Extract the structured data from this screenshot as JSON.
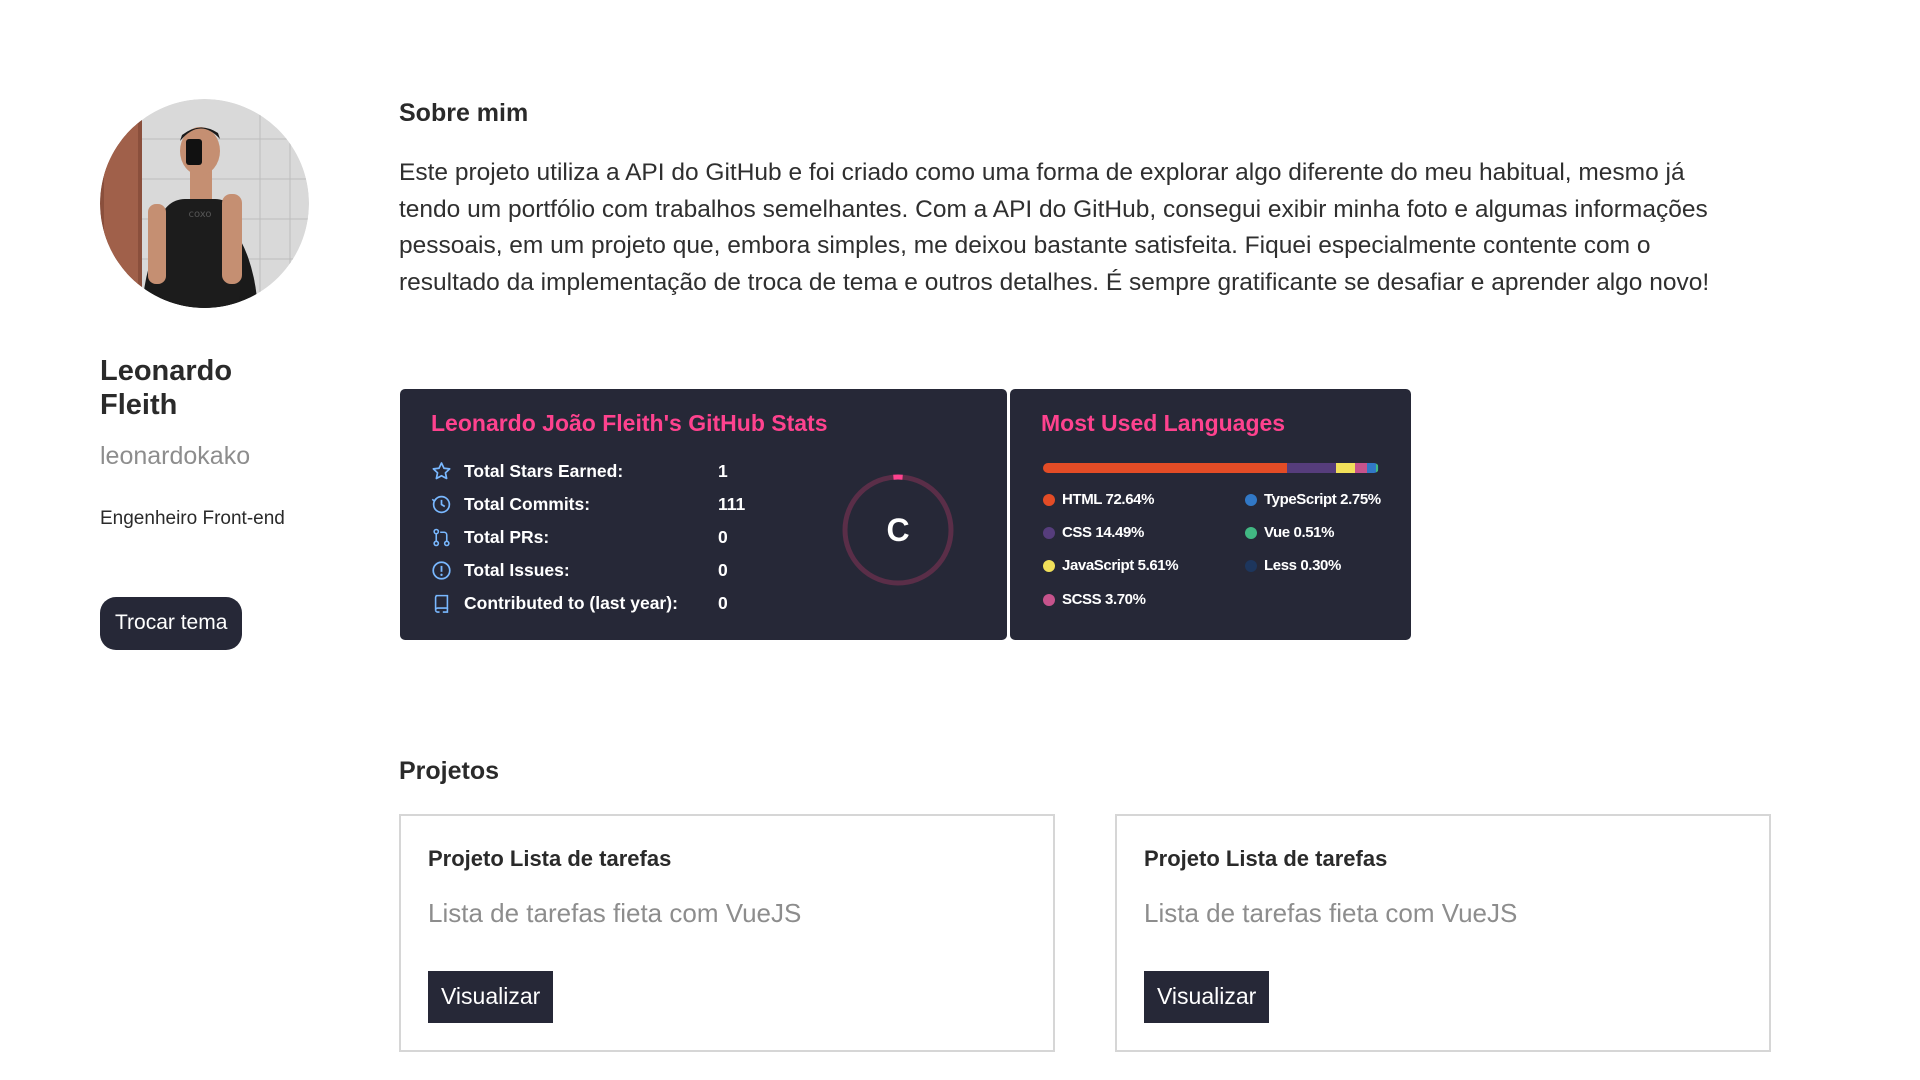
{
  "profile": {
    "name": "Leonardo Fleith",
    "username": "leonardokako",
    "role": "Engenheiro Front-end",
    "theme_button": "Trocar tema",
    "avatar_icon": "person-photo"
  },
  "about": {
    "title": "Sobre mim",
    "text": "Este projeto utiliza a API do GitHub e foi criado como uma forma de explorar algo diferente do meu habitual, mesmo já tendo um portfólio com trabalhos semelhantes. Com a API do GitHub, consegui exibir minha foto e algumas informações pessoais, em um projeto que, embora simples, me deixou bastante satisfeita. Fiquei especialmente contente com o resultado da implementação de troca de tema e outros detalhes. É sempre gratificante se desafiar e aprender algo novo!"
  },
  "github_stats": {
    "title": "Leonardo João Fleith's GitHub Stats",
    "rank": "C",
    "stats": [
      {
        "icon": "star-icon",
        "label": "Total Stars Earned:",
        "value": "1"
      },
      {
        "icon": "history-icon",
        "label": "Total Commits:",
        "value": "111"
      },
      {
        "icon": "pull-request-icon",
        "label": "Total PRs:",
        "value": "0"
      },
      {
        "icon": "issue-icon",
        "label": "Total Issues:",
        "value": "0"
      },
      {
        "icon": "repo-icon",
        "label": "Contributed to (last year):",
        "value": "0"
      }
    ]
  },
  "languages": {
    "title": "Most Used Languages",
    "items": [
      {
        "name": "HTML",
        "percent": "72.64%",
        "value": 72.64,
        "color": "#e34c26"
      },
      {
        "name": "CSS",
        "percent": "14.49%",
        "value": 14.49,
        "color": "#563d7c"
      },
      {
        "name": "JavaScript",
        "percent": "5.61%",
        "value": 5.61,
        "color": "#f1e05a"
      },
      {
        "name": "SCSS",
        "percent": "3.70%",
        "value": 3.7,
        "color": "#c6538c"
      },
      {
        "name": "TypeScript",
        "percent": "2.75%",
        "value": 2.75,
        "color": "#3178c6"
      },
      {
        "name": "Vue",
        "percent": "0.51%",
        "value": 0.51,
        "color": "#41b883"
      },
      {
        "name": "Less",
        "percent": "0.30%",
        "value": 0.3,
        "color": "#1d365d"
      }
    ]
  },
  "projects": {
    "title": "Projetos",
    "items": [
      {
        "title": "Projeto Lista de tarefas",
        "description": "Lista de tarefas fieta com VueJS",
        "button": "Visualizar"
      },
      {
        "title": "Projeto Lista de tarefas",
        "description": "Lista de tarefas fieta com VueJS",
        "button": "Visualizar"
      }
    ]
  },
  "colors": {
    "card_bg": "#262837",
    "accent_pink": "#fe428e",
    "icon_blue": "#79b8ff"
  }
}
